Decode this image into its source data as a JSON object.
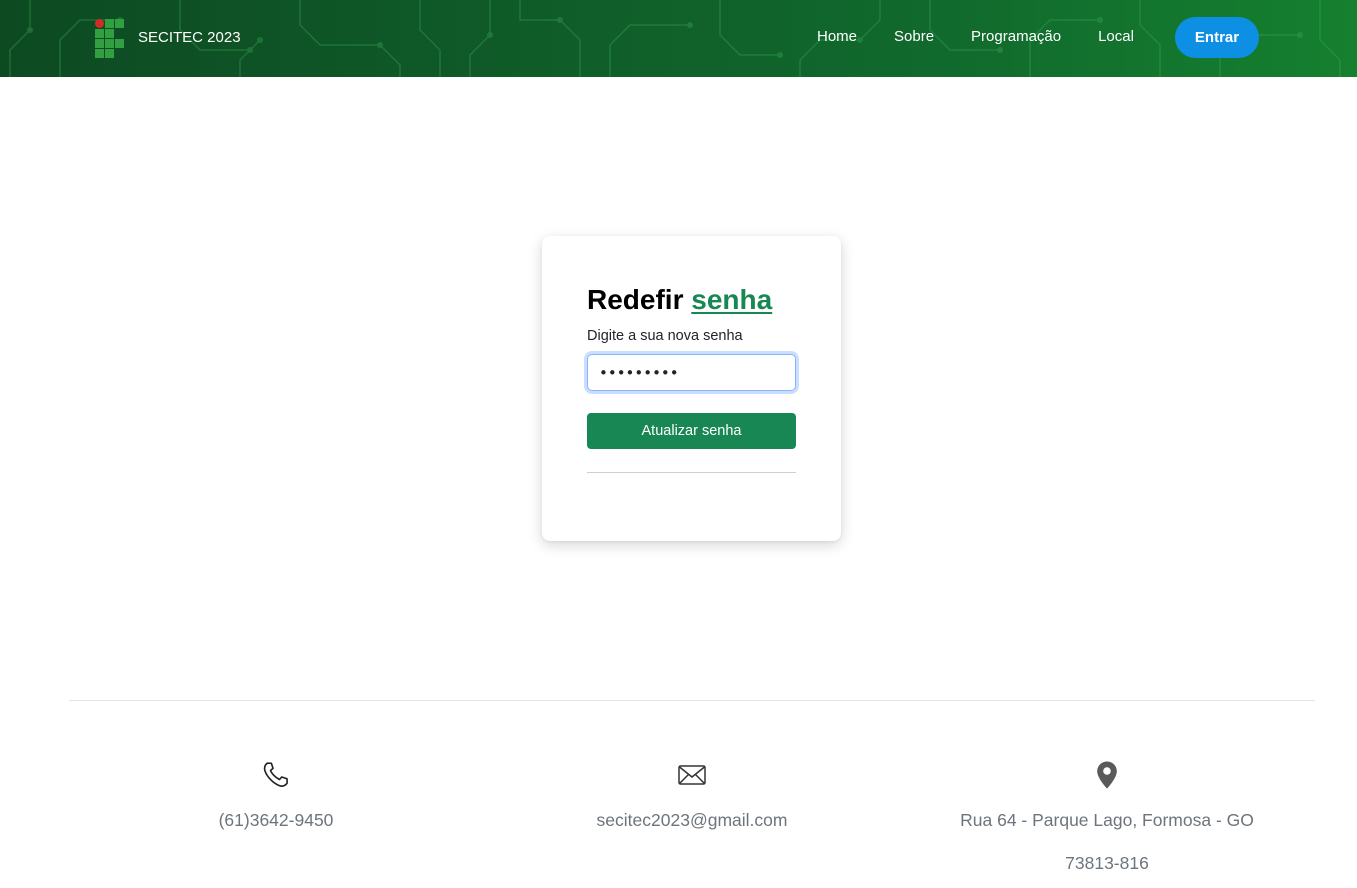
{
  "header": {
    "brand_name": "SECITEC 2023",
    "nav": [
      "Home",
      "Sobre",
      "Programação",
      "Local"
    ],
    "login_label": "Entrar",
    "colors": {
      "background": "#0f5a28",
      "login_button": "#0d8fe3",
      "logo_dot": "#d6292a",
      "logo_squares": "#32a041"
    }
  },
  "card": {
    "title_prefix": "Redefir",
    "title_accent": "senha",
    "subtitle": "Digite a sua nova senha",
    "password_value": "123456789",
    "submit_label": "Atualizar senha",
    "accent_color": "#198754"
  },
  "footer": {
    "phone": {
      "icon": "phone-icon",
      "text": "(61)3642-9450"
    },
    "email": {
      "icon": "envelope-icon",
      "text": "secitec2023@gmail.com"
    },
    "address": {
      "icon": "map-pin-icon",
      "text": "Rua 64 - Parque Lago, Formosa - GO",
      "cep": "73813-816"
    }
  }
}
